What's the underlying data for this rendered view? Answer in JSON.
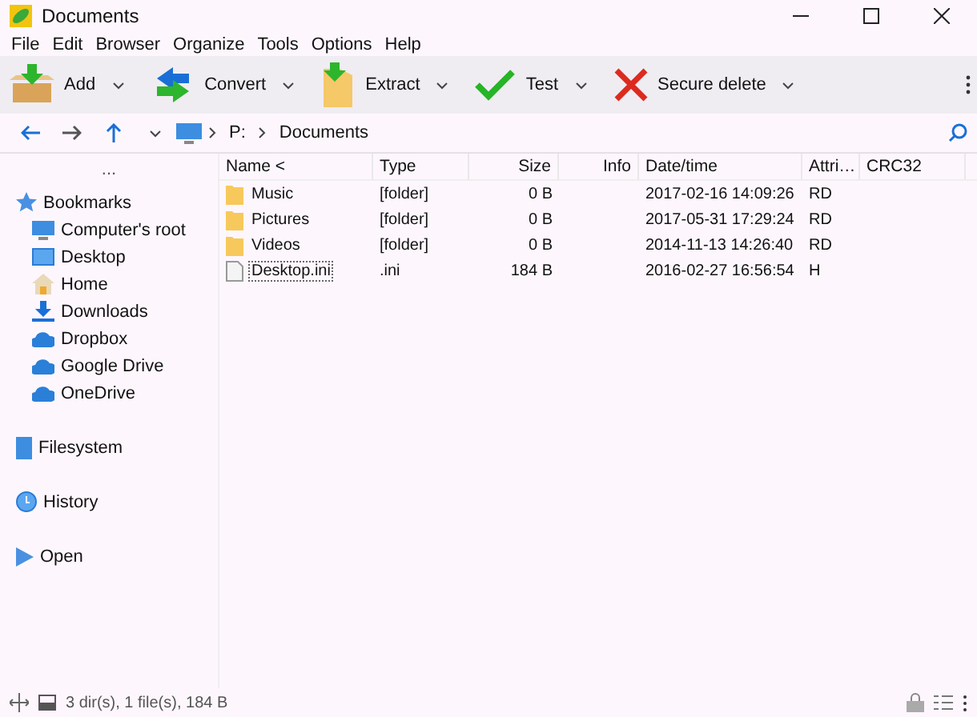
{
  "window": {
    "title": "Documents"
  },
  "menu": [
    "File",
    "Edit",
    "Browser",
    "Organize",
    "Tools",
    "Options",
    "Help"
  ],
  "toolbar": [
    {
      "kind": "add",
      "label": "Add"
    },
    {
      "kind": "convert",
      "label": "Convert"
    },
    {
      "kind": "extract",
      "label": "Extract"
    },
    {
      "kind": "test",
      "label": "Test"
    },
    {
      "kind": "delete",
      "label": "Secure delete"
    }
  ],
  "path": [
    "P:",
    "Documents"
  ],
  "sidebar": {
    "more": "...",
    "sections": [
      {
        "kind": "bookmarks",
        "label": "Bookmarks",
        "children": [
          {
            "kind": "computer",
            "label": "Computer's root"
          },
          {
            "kind": "desktop",
            "label": "Desktop"
          },
          {
            "kind": "home",
            "label": "Home"
          },
          {
            "kind": "downloads",
            "label": "Downloads"
          },
          {
            "kind": "cloud",
            "label": "Dropbox"
          },
          {
            "kind": "cloud",
            "label": "Google Drive"
          },
          {
            "kind": "cloud",
            "label": "OneDrive"
          }
        ]
      },
      {
        "kind": "filesystem",
        "label": "Filesystem"
      },
      {
        "kind": "history",
        "label": "History"
      },
      {
        "kind": "open",
        "label": "Open"
      }
    ]
  },
  "table": {
    "columns": [
      "Name <",
      "Type",
      "Size",
      "Info",
      "Date/time",
      "Attri…",
      "CRC32"
    ],
    "rows": [
      {
        "kind": "folder",
        "focused": false,
        "cells": [
          "Music",
          "[folder]",
          "0 B",
          "",
          "2017-02-16 14:09:26",
          "RD",
          ""
        ]
      },
      {
        "kind": "folder",
        "focused": false,
        "cells": [
          "Pictures",
          "[folder]",
          "0 B",
          "",
          "2017-05-31 17:29:24",
          "RD",
          ""
        ]
      },
      {
        "kind": "folder",
        "focused": false,
        "cells": [
          "Videos",
          "[folder]",
          "0 B",
          "",
          "2014-11-13 14:26:40",
          "RD",
          ""
        ]
      },
      {
        "kind": "file",
        "focused": true,
        "cells": [
          "Desktop.ini",
          ".ini",
          "184 B",
          "",
          "2016-02-27 16:56:54",
          "H",
          ""
        ]
      }
    ]
  },
  "status_bar": {
    "text": "3 dir(s), 1 file(s), 184 B"
  }
}
